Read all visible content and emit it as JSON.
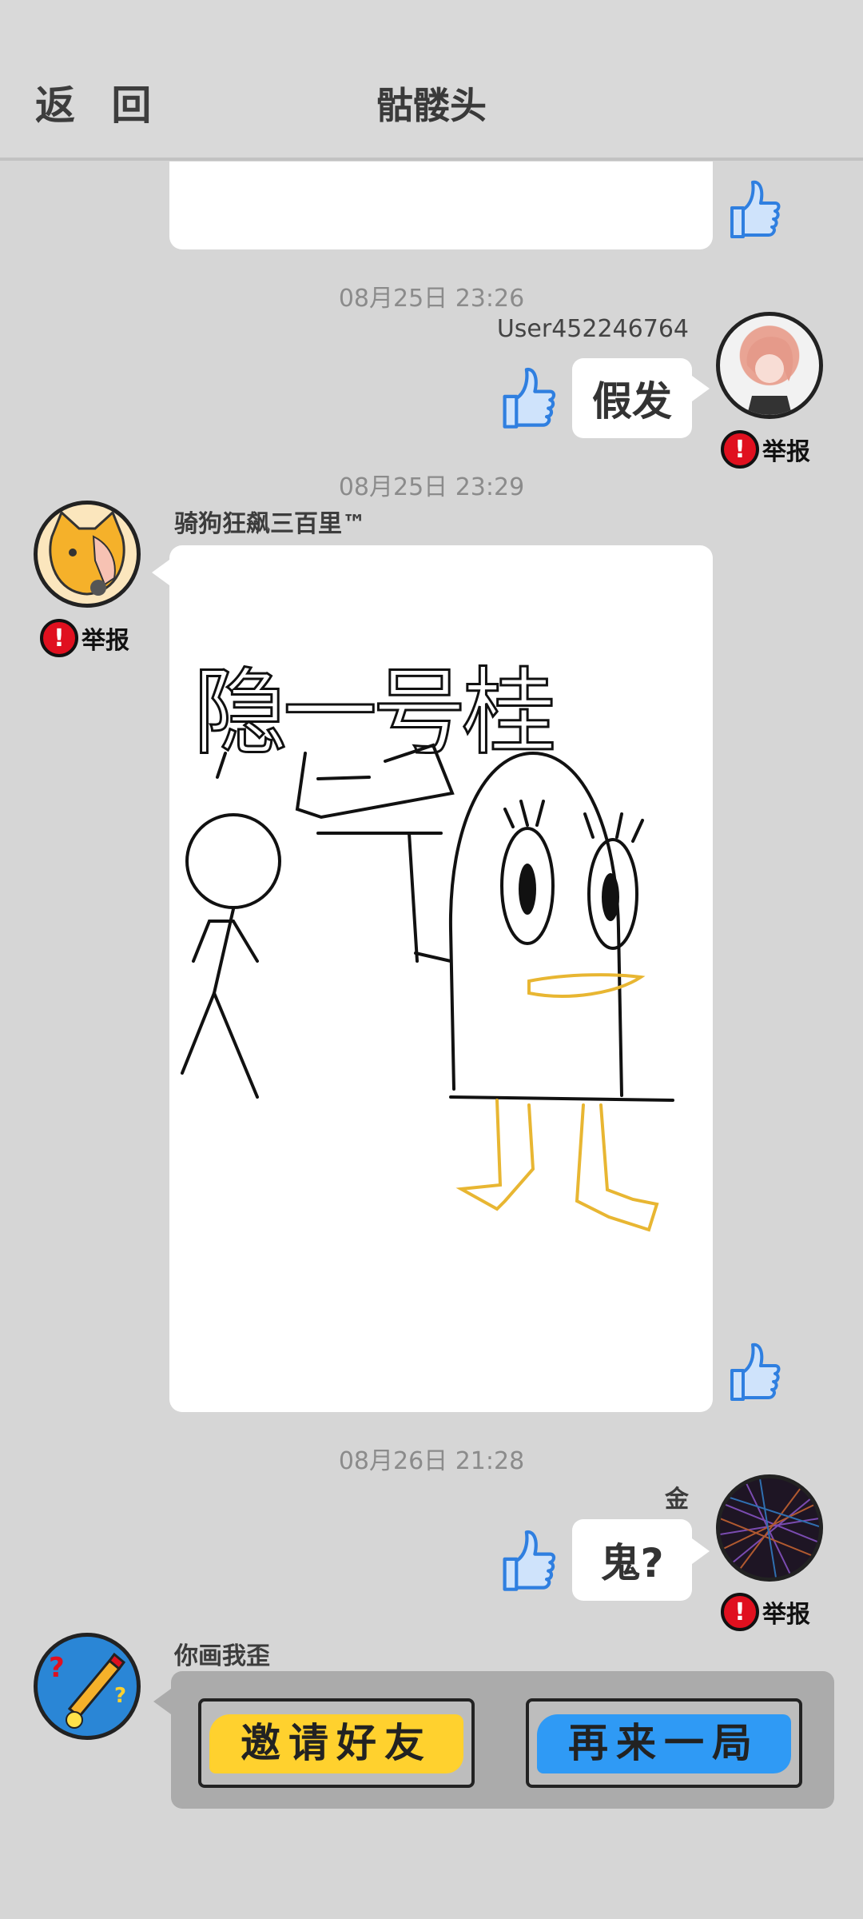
{
  "header": {
    "back_label": "返 回",
    "title": "骷髅头"
  },
  "messages": [
    {
      "time": "08月25日  23:26",
      "user": "User452246764",
      "text": "假发",
      "report": "举报"
    },
    {
      "time": "08月25日  23:29",
      "user": "骑狗狂飙三百里™",
      "report": "举报",
      "drawing_text": "隐一号桂"
    },
    {
      "time": "08月26日  21:28",
      "user": "金",
      "text": "鬼?",
      "report": "举报"
    },
    {
      "user": "你画我歪"
    }
  ],
  "game": {
    "invite_label": "邀请好友",
    "again_label": "再来一局",
    "invite_color": "#ffd12e",
    "again_color": "#2f9af5"
  },
  "colors": {
    "like_blue": "#2f7fe0",
    "report_red": "#e0101f"
  }
}
